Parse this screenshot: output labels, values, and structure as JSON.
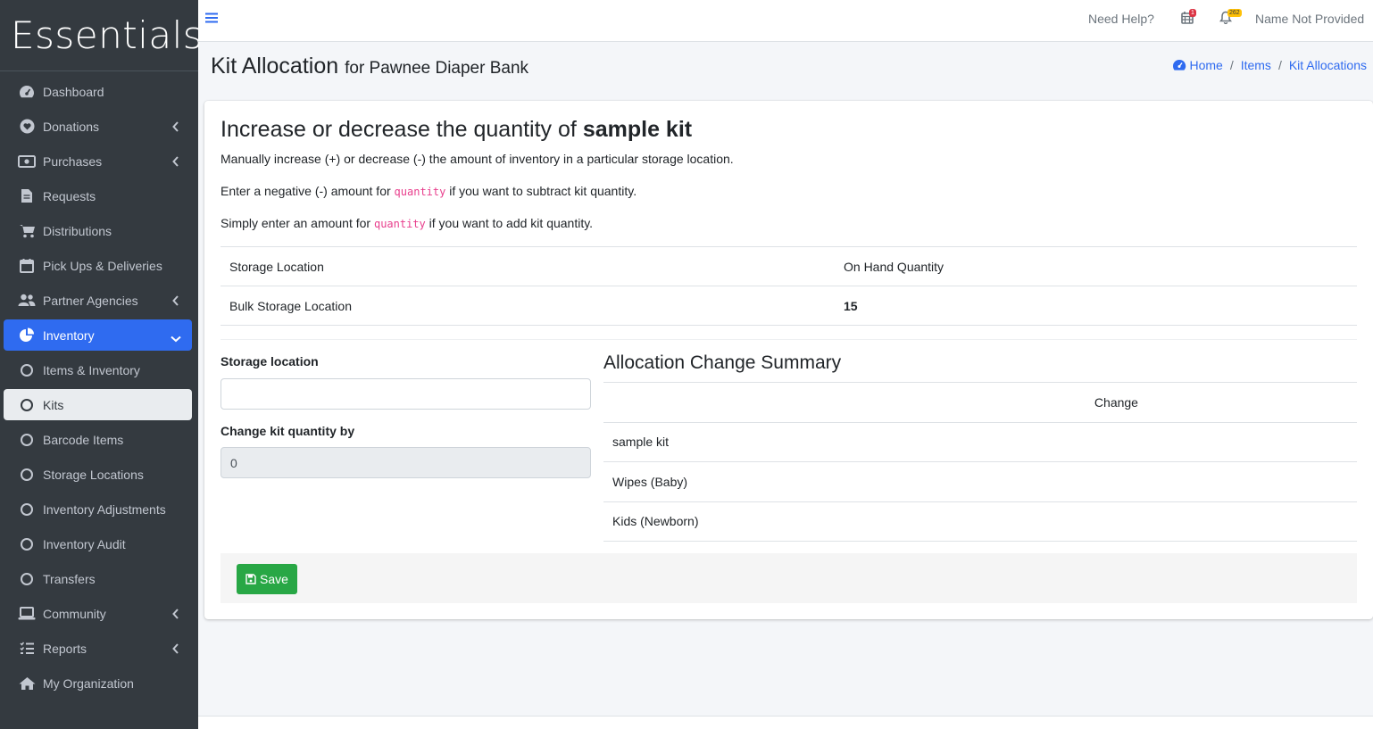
{
  "brand": "Essentials",
  "sidebar": {
    "items": [
      {
        "label": "Dashboard",
        "icon": "dashboard-icon"
      },
      {
        "label": "Donations",
        "icon": "heart-icon"
      },
      {
        "label": "Purchases",
        "icon": "money-icon"
      },
      {
        "label": "Requests",
        "icon": "file-icon"
      },
      {
        "label": "Distributions",
        "icon": "cart-icon"
      },
      {
        "label": "Pick Ups & Deliveries",
        "icon": "calendar-icon"
      },
      {
        "label": "Partner Agencies",
        "icon": "users-icon"
      },
      {
        "label": "Inventory",
        "icon": "pie-chart-icon"
      },
      {
        "label": "Items & Inventory",
        "icon": "circle-icon"
      },
      {
        "label": "Kits",
        "icon": "circle-icon"
      },
      {
        "label": "Barcode Items",
        "icon": "circle-icon"
      },
      {
        "label": "Storage Locations",
        "icon": "circle-icon"
      },
      {
        "label": "Inventory Adjustments",
        "icon": "circle-icon"
      },
      {
        "label": "Inventory Audit",
        "icon": "circle-icon"
      },
      {
        "label": "Transfers",
        "icon": "circle-icon"
      },
      {
        "label": "Community",
        "icon": "laptop-icon"
      },
      {
        "label": "Reports",
        "icon": "list-icon"
      },
      {
        "label": "My Organization",
        "icon": "home-icon"
      }
    ]
  },
  "topbar": {
    "help": "Need Help?",
    "calendar_badge": "1",
    "bell_badge": "262",
    "user": "Name Not Provided"
  },
  "header": {
    "title": "Kit Allocation",
    "subtitle": "for Pawnee Diaper Bank"
  },
  "breadcrumb": {
    "home": "Home",
    "items": "Items",
    "current": "Kit Allocations"
  },
  "card": {
    "heading_prefix": "Increase or decrease the quantity of",
    "heading_kit": "sample kit",
    "line1": "Manually increase (+) or decrease (-) the amount of inventory in a particular storage location.",
    "line2_pre": "Enter a negative (-) amount for",
    "line2_code": "quantity",
    "line2_post": "if you want to subtract kit quantity.",
    "line3_pre": "Simply enter an amount for",
    "line3_code": "quantity",
    "line3_post": "if you want to add kit quantity."
  },
  "locations_table": {
    "headers": [
      "Storage Location",
      "On Hand Quantity"
    ],
    "rows": [
      [
        "Bulk Storage Location",
        "15"
      ]
    ]
  },
  "form": {
    "storage_label": "Storage location",
    "storage_value": "",
    "quantity_label": "Change kit quantity by",
    "quantity_value": "0"
  },
  "summary": {
    "title": "Allocation Change Summary",
    "header_change": "Change",
    "rows": [
      "sample kit",
      "Wipes (Baby)",
      "Kids (Newborn)"
    ]
  },
  "save_label": "Save",
  "colors": {
    "sidebar_bg": "#343a40",
    "active": "#2f6bf0",
    "save": "#28a745",
    "code": "#e83e8c"
  }
}
